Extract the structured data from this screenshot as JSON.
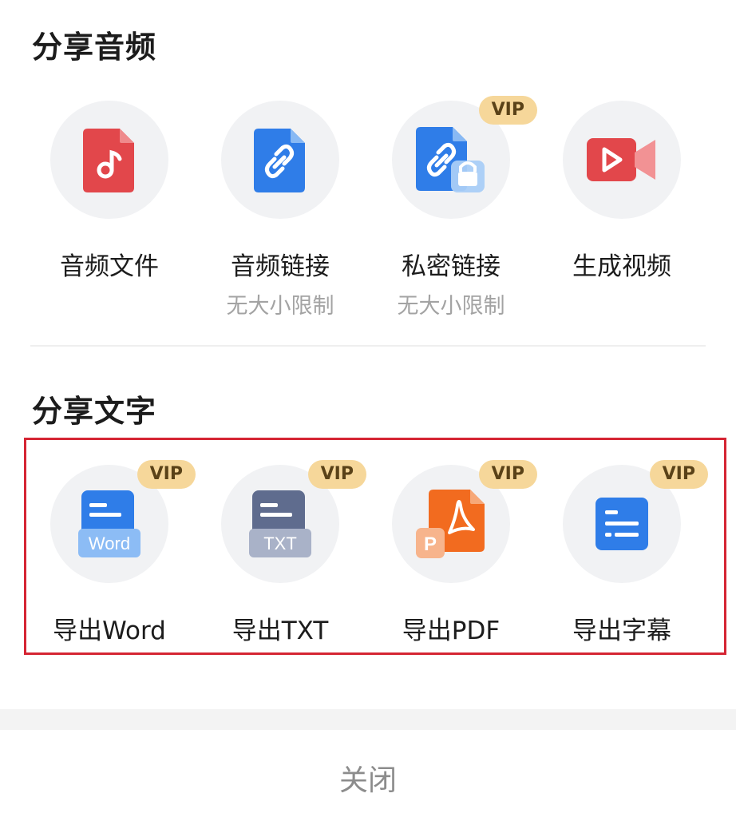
{
  "audio_section": {
    "title": "分享音频",
    "items": [
      {
        "label": "音频文件",
        "sub": "",
        "vip": "",
        "icon": "audio-file-icon"
      },
      {
        "label": "音频链接",
        "sub": "无大小限制",
        "vip": "",
        "icon": "link-file-icon"
      },
      {
        "label": "私密链接",
        "sub": "无大小限制",
        "vip": "VIP",
        "icon": "locked-link-icon"
      },
      {
        "label": "生成视频",
        "sub": "",
        "vip": "",
        "icon": "video-icon"
      }
    ]
  },
  "text_section": {
    "title": "分享文字",
    "items": [
      {
        "label": "导出Word",
        "vip": "VIP",
        "icon": "word-doc-icon",
        "icon_text": "Word"
      },
      {
        "label": "导出TXT",
        "vip": "VIP",
        "icon": "txt-doc-icon",
        "icon_text": "TXT"
      },
      {
        "label": "导出PDF",
        "vip": "VIP",
        "icon": "pdf-doc-icon",
        "icon_text": "P"
      },
      {
        "label": "导出字幕",
        "vip": "VIP",
        "icon": "subtitle-icon",
        "icon_text": ""
      }
    ]
  },
  "footer": {
    "close_label": "关闭"
  },
  "colors": {
    "highlight_border": "#d52533",
    "vip_badge": "#f6d79a",
    "circle_bg": "#f1f2f4"
  }
}
